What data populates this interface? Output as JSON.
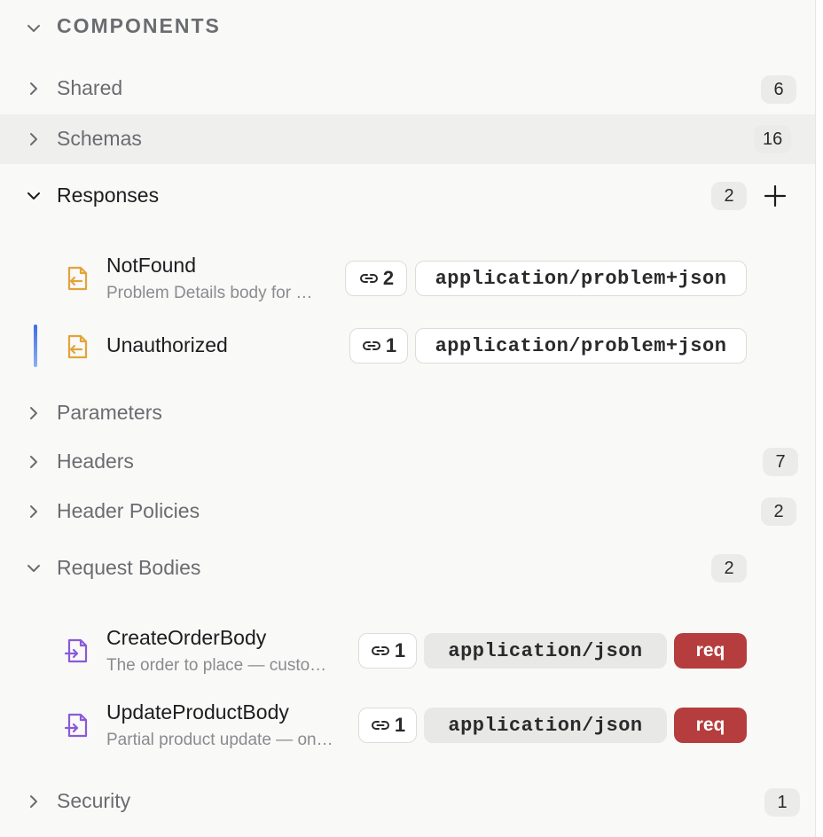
{
  "header": {
    "label": "COMPONENTS"
  },
  "sections": {
    "shared": {
      "label": "Shared",
      "count": "6"
    },
    "schemas": {
      "label": "Schemas",
      "count": "16"
    },
    "responses": {
      "label": "Responses",
      "count": "2",
      "items": [
        {
          "title": "NotFound",
          "desc": "Problem Details body for …",
          "refs": "2",
          "mime": "application/problem+json"
        },
        {
          "title": "Unauthorized",
          "refs": "1",
          "mime": "application/problem+json"
        }
      ]
    },
    "parameters": {
      "label": "Parameters"
    },
    "headers": {
      "label": "Headers",
      "count": "7"
    },
    "header_policies": {
      "label": "Header Policies",
      "count": "2"
    },
    "request_bodies": {
      "label": "Request Bodies",
      "count": "2",
      "items": [
        {
          "title": "CreateOrderBody",
          "desc": "The order to place — custo…",
          "refs": "1",
          "mime": "application/json",
          "required": "req"
        },
        {
          "title": "UpdateProductBody",
          "desc": "Partial product update — on…",
          "refs": "1",
          "mime": "application/json",
          "required": "req"
        }
      ]
    },
    "security": {
      "label": "Security",
      "count": "1"
    }
  },
  "icons": {
    "collapse": "chevron-down-icon",
    "expand": "chevron-right-icon",
    "add": "plus-icon",
    "link": "link-icon",
    "response": "file-arrow-left-icon",
    "request": "file-arrow-right-icon"
  },
  "colors": {
    "response_icon": "#e3a43a",
    "request_icon": "#8a5ad8",
    "required_badge": "#b63d3d",
    "active_indicator": "#3b6fe0",
    "hover_row": "#efefee"
  }
}
